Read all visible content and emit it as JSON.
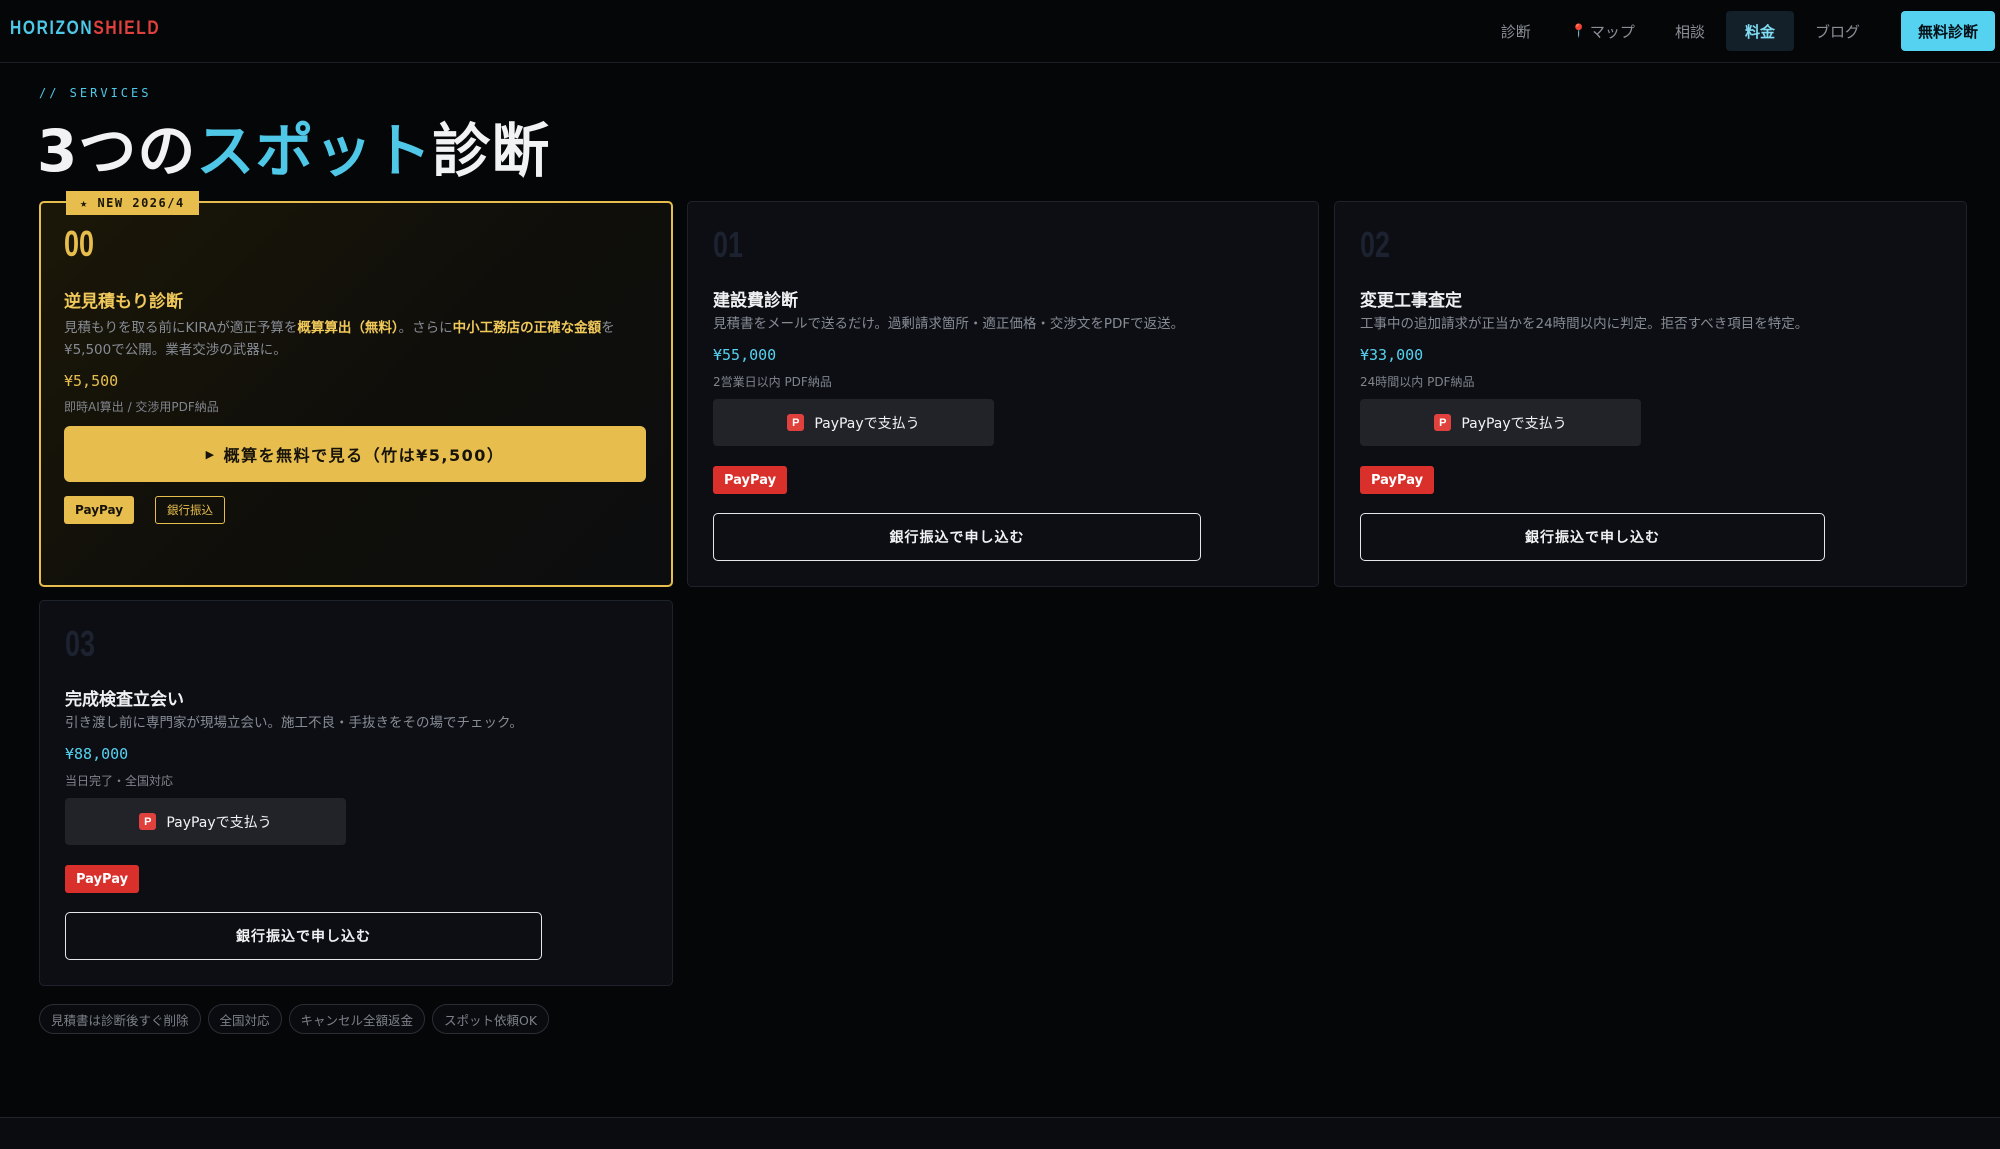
{
  "header": {
    "logo_a": "HORIZON",
    "logo_b": "SHIELD",
    "nav": [
      "診断",
      "マップ",
      "相談",
      "料金",
      "ブログ"
    ],
    "nav_active_index": 3,
    "cta": "無料診断"
  },
  "section": {
    "eyebrow": "// SERVICES",
    "title_a": "3つの",
    "title_hl": "スポット",
    "title_b": "診断"
  },
  "featured": {
    "badge": "★ NEW 2026/4",
    "num": "00",
    "title": "逆見積もり診断",
    "desc_1": "見積もりを取る前にKIRAが適正予算を",
    "desc_b1": "概算算出（無料）",
    "desc_2": "。さらに",
    "desc_b2": "中小工務店の正確な金額",
    "desc_3": "を¥5,500で公開。業者交渉の武器に。",
    "price": "¥5,500",
    "meta": "即時AI算出 / 交渉用PDF納品",
    "button": "概算を無料で見る（竹は¥5,500）",
    "chip_paypay": "PayPay",
    "chip_bank": "銀行振込"
  },
  "cards": [
    {
      "num": "01",
      "title": "建設費診断",
      "desc": "見積書をメールで送るだけ。過剰請求箇所・適正価格・交渉文をPDFで返送。",
      "price": "¥55,000",
      "meta": "2営業日以内 PDF納品",
      "paypay_button": "PayPayで支払う",
      "paypay_badge": "PayPay",
      "bank_button": "銀行振込で申し込む"
    },
    {
      "num": "02",
      "title": "変更工事査定",
      "desc": "工事中の追加請求が正当かを24時間以内に判定。拒否すべき項目を特定。",
      "price": "¥33,000",
      "meta": "24時間以内 PDF納品",
      "paypay_button": "PayPayで支払う",
      "paypay_badge": "PayPay",
      "bank_button": "銀行振込で申し込む"
    },
    {
      "num": "03",
      "title": "完成検査立会い",
      "desc": "引き渡し前に専門家が現場立会い。施工不良・手抜きをその場でチェック。",
      "price": "¥88,000",
      "meta": "当日完了・全国対応",
      "paypay_button": "PayPayで支払う",
      "paypay_badge": "PayPay",
      "bank_button": "銀行振込で申し込む"
    }
  ],
  "tags": [
    "見積書は診断後すぐ削除",
    "全国対応",
    "キャンセル全額返金",
    "スポット依頼OK"
  ],
  "icons": {
    "pin": "map-pin-icon",
    "paypay": "paypay-icon",
    "play": "play-triangle-icon"
  },
  "colors": {
    "accent": "#4fc8e8",
    "gold": "#e7be4e",
    "brand_red": "#e0413c",
    "paypay_red": "#d9302b"
  }
}
